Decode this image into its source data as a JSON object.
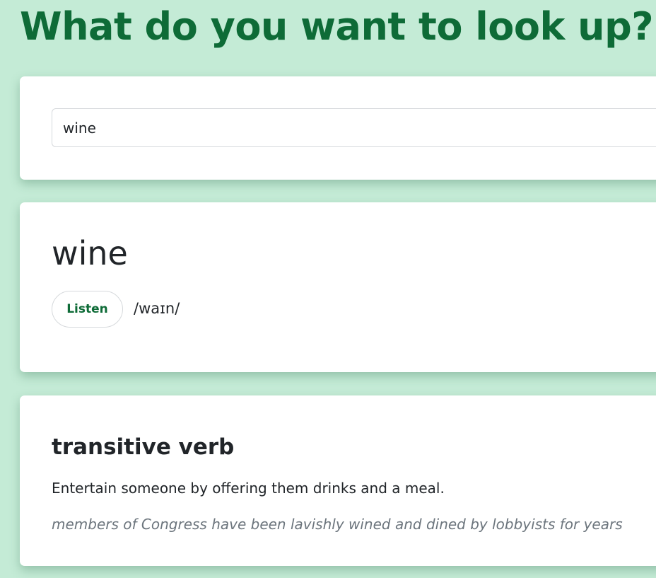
{
  "header": {
    "title": "What do you want to look up?"
  },
  "search": {
    "value": "wine",
    "placeholder": ""
  },
  "entry": {
    "word": "wine",
    "listen_label": "Listen",
    "phonetic": "/waɪn/"
  },
  "meanings": [
    {
      "part_of_speech": "transitive verb",
      "definition": "Entertain someone by offering them drinks and a meal.",
      "example": "members of Congress have been lavishly wined and dined by lobbyists for years"
    }
  ],
  "colors": {
    "background": "#c4ebd6",
    "accent": "#0e6b37",
    "card": "#ffffff",
    "muted_text": "#6c757d"
  }
}
